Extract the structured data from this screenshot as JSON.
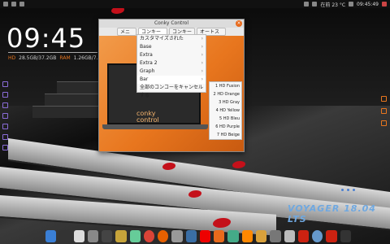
{
  "top_panel": {
    "right_status": "在前 23 °C",
    "time": "09:45:49"
  },
  "clock": {
    "time": "09:45",
    "hd_label": "HD",
    "hd_value": "28.5GB/37.2GB",
    "ram_label": "RAM",
    "ram_value": "1.26GB/7.81GB"
  },
  "desktop": {
    "voyager_text": "VOYAGER 18.04 LTS"
  },
  "window": {
    "title": "Conky Control",
    "close_label": "×",
    "menus": [
      "メニュー",
      "コンキーリスト",
      "コンキー管理",
      "オートスタート"
    ],
    "logo_line1": "conky",
    "logo_line2": "control"
  },
  "dropdown": {
    "items": [
      "カスタマイズされた",
      "Base",
      "Extra",
      "Extra 2",
      "Graph",
      "Bar",
      "全部のコンコーをキャンセルする"
    ]
  },
  "submenu": {
    "items": [
      "1 HD Fusion",
      "2 HD Orange",
      "3 HD Gray",
      "4 HD Yellow",
      "5 HD Bleu",
      "6 HD Purple",
      "7 HD Beige"
    ]
  },
  "colors": {
    "accent": "#e8761e",
    "voyager_blue": "#6fa8e0"
  }
}
